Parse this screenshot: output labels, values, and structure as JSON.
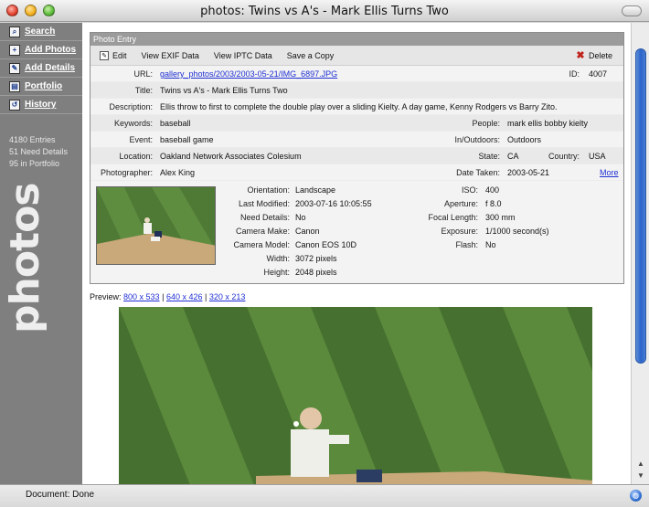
{
  "window": {
    "title": "photos: Twins vs A's - Mark Ellis Turns Two"
  },
  "sidebar": {
    "items": [
      {
        "label": "Search",
        "icon": "search-icon"
      },
      {
        "label": "Add Photos",
        "icon": "add-photos-icon"
      },
      {
        "label": "Add Details",
        "icon": "add-details-icon"
      },
      {
        "label": "Portfolio",
        "icon": "portfolio-icon"
      },
      {
        "label": "History",
        "icon": "history-icon"
      }
    ],
    "stats": [
      "4180 Entries",
      "51 Need Details",
      "95 in Portfolio"
    ],
    "logo": "photos"
  },
  "panel": {
    "header": "Photo Entry",
    "actions": {
      "edit": "Edit",
      "exif": "View EXIF Data",
      "iptc": "View IPTC Data",
      "save_copy": "Save a Copy",
      "delete": "Delete"
    }
  },
  "entry": {
    "url_label": "URL:",
    "url": "gallery_photos/2003/2003-05-21/IMG_6897.JPG",
    "id_label": "ID:",
    "id": "4007",
    "title_label": "Title:",
    "title": "Twins vs A's - Mark Ellis Turns Two",
    "description_label": "Description:",
    "description": "Ellis throw to first to complete the double play over a sliding Kielty. A day game, Kenny Rodgers vs Barry Zito.",
    "keywords_label": "Keywords:",
    "keywords": "baseball",
    "people_label": "People:",
    "people": "mark ellis bobby kielty",
    "event_label": "Event:",
    "event": "baseball game",
    "inout_label": "In/Outdoors:",
    "inout": "Outdoors",
    "location_label": "Location:",
    "location": "Oakland Network Associates Colesium",
    "state_label": "State:",
    "state": "CA",
    "country_label": "Country:",
    "country": "USA",
    "photographer_label": "Photographer:",
    "photographer": "Alex King",
    "date_label": "Date Taken:",
    "date": "2003-05-21",
    "more": "More"
  },
  "exif": {
    "left": [
      {
        "label": "Orientation:",
        "value": "Landscape"
      },
      {
        "label": "Last Modified:",
        "value": "2003-07-16 10:05:55"
      },
      {
        "label": "Need Details:",
        "value": "No"
      },
      {
        "label": "Camera Make:",
        "value": "Canon"
      },
      {
        "label": "Camera Model:",
        "value": "Canon EOS 10D"
      },
      {
        "label": "Width:",
        "value": "3072 pixels"
      },
      {
        "label": "Height:",
        "value": "2048 pixels"
      }
    ],
    "right": [
      {
        "label": "ISO:",
        "value": "400"
      },
      {
        "label": "Aperture:",
        "value": "f 8.0"
      },
      {
        "label": "Focal Length:",
        "value": "300 mm"
      },
      {
        "label": "Exposure:",
        "value": "1/1000 second(s)"
      },
      {
        "label": "Flash:",
        "value": "No"
      }
    ]
  },
  "preview": {
    "label": "Preview:",
    "sizes": [
      "800 x 533",
      "640 x 426",
      "320 x 213"
    ],
    "sep": "|"
  },
  "status": {
    "text": "Document: Done"
  },
  "colors": {
    "sidebar": "#7f7f7f",
    "link": "#1f2fd3",
    "accent_scroll": "#2a63c9",
    "delete": "#c0241d"
  }
}
